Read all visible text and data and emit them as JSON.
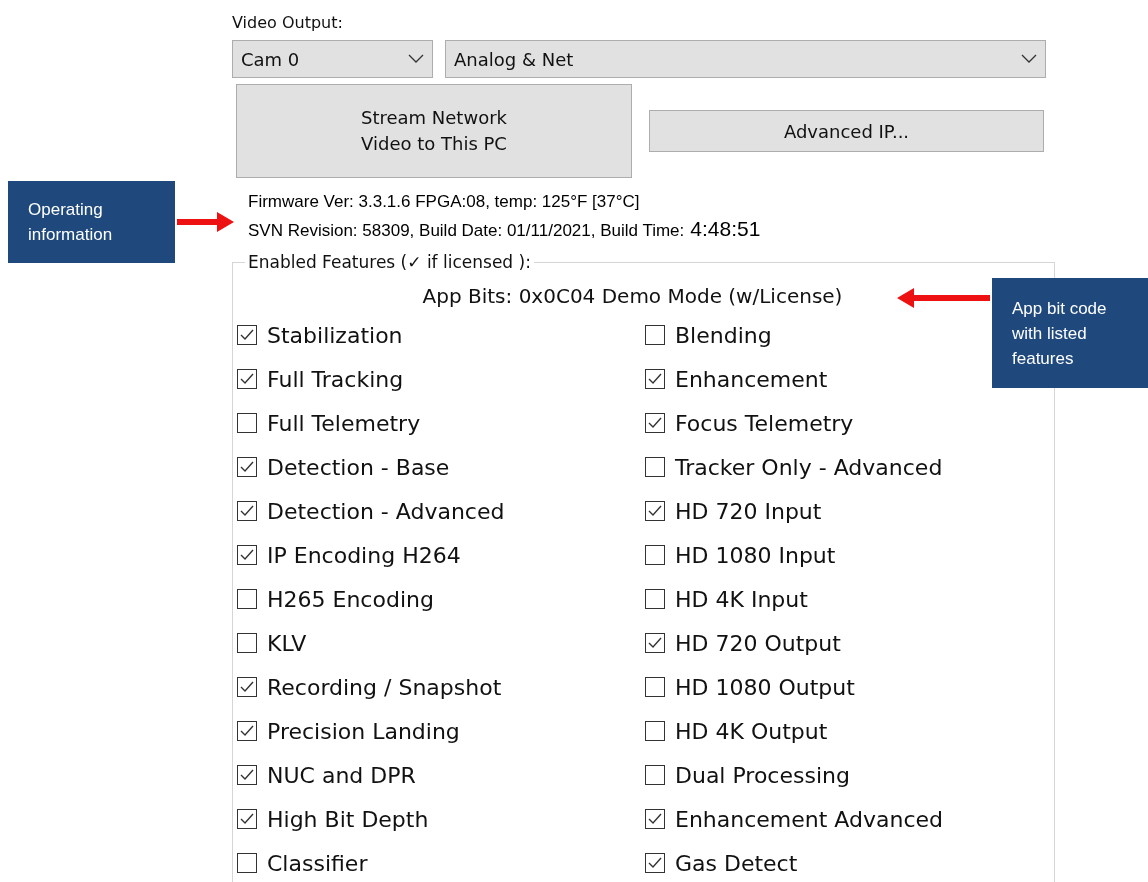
{
  "video_output": {
    "label": "Video Output:",
    "camera_select": "Cam 0",
    "mode_select": "Analog & Net"
  },
  "buttons": {
    "stream": "Stream Network\nVideo to This PC",
    "advanced_ip": "Advanced IP..."
  },
  "info": {
    "firmware": "Firmware Ver: 3.3.1.6 FPGA:08, temp: 125°F [37°C]",
    "svn": "SVN Revision: 58309, Build Date: 01/11/2021, Build Time:",
    "build_time": "4:48:51"
  },
  "features": {
    "title": "Enabled Features (✓ if licensed ):",
    "app_bits": "App Bits: 0x0C04 Demo Mode (w/License)",
    "left": [
      {
        "label": "Stabilization",
        "checked": true
      },
      {
        "label": "Full Tracking",
        "checked": true
      },
      {
        "label": "Full Telemetry",
        "checked": false
      },
      {
        "label": "Detection - Base",
        "checked": true
      },
      {
        "label": "Detection - Advanced",
        "checked": true
      },
      {
        "label": "IP Encoding H264",
        "checked": true
      },
      {
        "label": "H265 Encoding",
        "checked": false
      },
      {
        "label": "KLV",
        "checked": false
      },
      {
        "label": "Recording / Snapshot",
        "checked": true
      },
      {
        "label": "Precision Landing",
        "checked": true
      },
      {
        "label": "NUC and DPR",
        "checked": true
      },
      {
        "label": "High Bit Depth",
        "checked": true
      },
      {
        "label": "Classifier",
        "checked": false
      }
    ],
    "right": [
      {
        "label": "Blending",
        "checked": false
      },
      {
        "label": "Enhancement",
        "checked": true
      },
      {
        "label": "Focus Telemetry",
        "checked": true
      },
      {
        "label": "Tracker Only - Advanced",
        "checked": false
      },
      {
        "label": "HD 720 Input",
        "checked": true
      },
      {
        "label": "HD 1080 Input",
        "checked": false
      },
      {
        "label": "HD 4K Input",
        "checked": false
      },
      {
        "label": "HD 720 Output",
        "checked": true
      },
      {
        "label": "HD 1080 Output",
        "checked": false
      },
      {
        "label": "HD 4K Output",
        "checked": false
      },
      {
        "label": "Dual Processing",
        "checked": false
      },
      {
        "label": "Enhancement Advanced",
        "checked": true
      },
      {
        "label": "Gas Detect",
        "checked": true
      }
    ]
  },
  "callouts": [
    {
      "text": "Operating information"
    },
    {
      "text": "App bit code with listed features"
    }
  ]
}
